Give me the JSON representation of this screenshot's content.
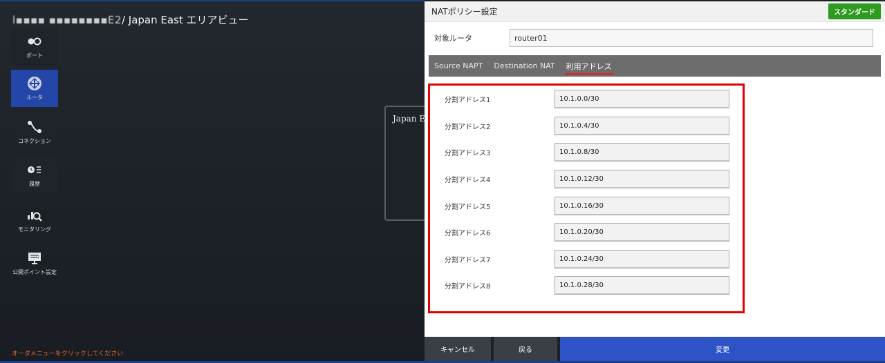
{
  "area": {
    "title_prefix": "l▪▪▪▪ ▪▪▪▪▪▪▪▪E2",
    "title": "/ Japan East エリアビュー",
    "diagram_label": "Japan Ea",
    "order_hint": "オーダメニューをクリックしてください"
  },
  "sidebar": {
    "items": [
      {
        "label": "ポート",
        "icon": "port-icon"
      },
      {
        "label": "ルータ",
        "icon": "router-icon"
      },
      {
        "label": "コネクション",
        "icon": "connection-icon"
      },
      {
        "label": "履歴",
        "icon": "history-icon"
      },
      {
        "label": "モニタリング",
        "icon": "monitoring-icon"
      },
      {
        "label": "公開ポイント設定",
        "icon": "public-point-icon"
      }
    ]
  },
  "dialog": {
    "title": "NATポリシー設定",
    "standard_badge": "スタンダード",
    "router_label": "対象ルータ",
    "router_value": "router01",
    "tabs": [
      {
        "label": "Source NAPT"
      },
      {
        "label": "Destination NAT"
      },
      {
        "label": "利用アドレス"
      }
    ],
    "addresses": [
      {
        "label": "分割アドレス1",
        "value": "10.1.0.0/30"
      },
      {
        "label": "分割アドレス2",
        "value": "10.1.0.4/30"
      },
      {
        "label": "分割アドレス3",
        "value": "10.1.0.8/30"
      },
      {
        "label": "分割アドレス4",
        "value": "10.1.0.12/30"
      },
      {
        "label": "分割アドレス5",
        "value": "10.1.0.16/30"
      },
      {
        "label": "分割アドレス6",
        "value": "10.1.0.20/30"
      },
      {
        "label": "分割アドレス7",
        "value": "10.1.0.24/30"
      },
      {
        "label": "分割アドレス8",
        "value": "10.1.0.28/30"
      }
    ],
    "buttons": {
      "cancel": "キャンセル",
      "back": "戻る",
      "change": "変更"
    }
  },
  "colors": {
    "accent": "#2d53c6",
    "highlight": "#e30000",
    "standard": "#2f9a20",
    "hint": "#e8692a"
  }
}
